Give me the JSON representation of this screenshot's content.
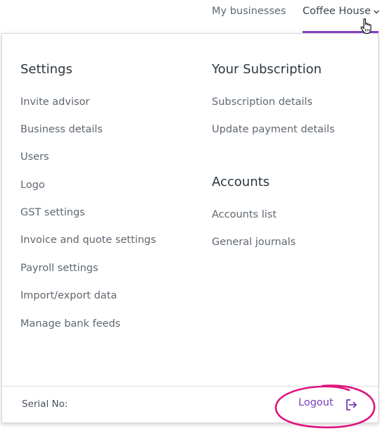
{
  "nav": {
    "my_businesses": "My businesses",
    "current_business": "Coffee House"
  },
  "settings": {
    "heading": "Settings",
    "items": [
      "Invite advisor",
      "Business details",
      "Users",
      "Logo",
      "GST settings",
      "Invoice and quote settings",
      "Payroll settings",
      "Import/export data",
      "Manage bank feeds"
    ]
  },
  "subscription": {
    "heading": "Your Subscription",
    "items": [
      "Subscription details",
      "Update payment details"
    ]
  },
  "accounts": {
    "heading": "Accounts",
    "items": [
      "Accounts list",
      "General journals"
    ]
  },
  "footer": {
    "serial_label": "Serial No:",
    "logout_label": "Logout"
  },
  "colors": {
    "accent": "#8a44c8",
    "annotation": "#e0147f"
  },
  "icons": {
    "chevron": "chevron-down-icon",
    "logout": "logout-icon",
    "cursor": "hand-pointer-icon"
  }
}
